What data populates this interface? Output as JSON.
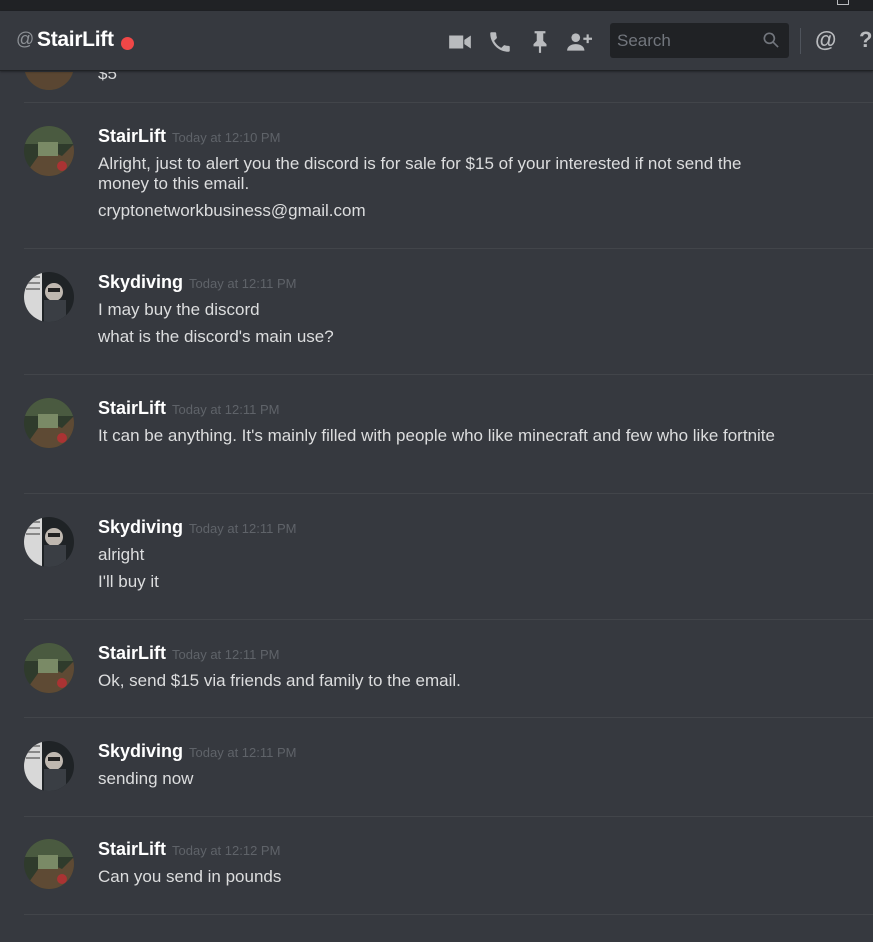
{
  "header": {
    "at_symbol": "@",
    "channel_name": "StairLift",
    "status_color": "#f04747",
    "icons": [
      "video-call-icon",
      "voice-call-icon",
      "pinned-messages-icon",
      "add-friend-icon"
    ],
    "search_placeholder": "Search",
    "mention_symbol": "@",
    "help_symbol": "?"
  },
  "previous_message_fragment": "$5",
  "messages": [
    {
      "author": "StairLift",
      "timestamp": "Today at 12:10 PM",
      "lines": [
        "Alright, just to alert you the discord is for sale for $15 of your interested if not send the money to this email.",
        "cryptonetworkbusiness@gmail.com"
      ]
    },
    {
      "author": "Skydiving",
      "timestamp": "Today at 12:11 PM",
      "lines": [
        "I may buy the discord",
        "what is the discord's main use?"
      ]
    },
    {
      "author": "StairLift",
      "timestamp": "Today at 12:11 PM",
      "lines": [
        "It can be anything. It's mainly filled with people who like minecraft and few who like fortnite"
      ]
    },
    {
      "author": "Skydiving",
      "timestamp": "Today at 12:11 PM",
      "lines": [
        "alright",
        "I'll buy it"
      ]
    },
    {
      "author": "StairLift",
      "timestamp": "Today at 12:11 PM",
      "lines": [
        "Ok, send $15 via friends and family to the email."
      ]
    },
    {
      "author": "Skydiving",
      "timestamp": "Today at 12:11 PM",
      "lines": [
        "sending now"
      ]
    },
    {
      "author": "StairLift",
      "timestamp": "Today at 12:12 PM",
      "lines": [
        "Can you send in pounds"
      ]
    }
  ]
}
